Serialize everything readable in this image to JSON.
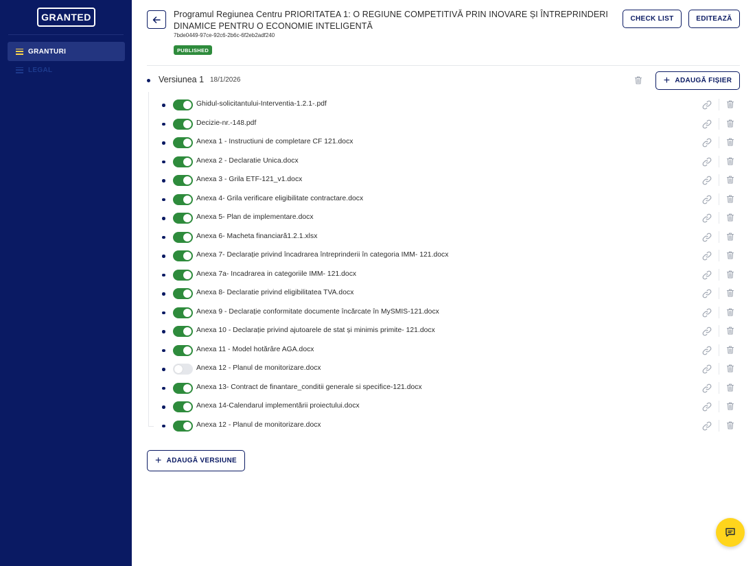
{
  "sidebar": {
    "logo": "GRANTED",
    "items": [
      {
        "label": "GRANTURI",
        "active": true
      },
      {
        "label": "LEGAL",
        "active": false
      }
    ]
  },
  "header": {
    "title": "Programul Regiunea Centru PRIORITATEA 1: O REGIUNE COMPETITIVĂ PRIN INOVARE ȘI ÎNTREPRINDERI DINAMICE PENTRU O ECONOMIE INTELIGENTĂ",
    "id": "7bde0449-97ce-92c6-2b6c-6f2eb2adf240",
    "status_badge": "PUBLISHED",
    "checklist_label": "CHECK LIST",
    "edit_label": "EDITEAZĂ"
  },
  "version": {
    "name": "Versiunea 1",
    "date": "18/1/2026",
    "add_file_label": "ADAUGĂ FIȘIER",
    "files": [
      {
        "name": "Ghidul-solicitantului-Interventia-1.2.1-.pdf",
        "enabled": true
      },
      {
        "name": "Decizie-nr.-148.pdf",
        "enabled": true
      },
      {
        "name": "Anexa 1 - Instructiuni de completare  CF 121.docx",
        "enabled": true
      },
      {
        "name": "Anexa 2 - Declaratie Unica.docx",
        "enabled": true
      },
      {
        "name": "Anexa 3 - Grila ETF-121_v1.docx",
        "enabled": true
      },
      {
        "name": "Anexa 4- Grila verificare eligibilitate contractare.docx",
        "enabled": true
      },
      {
        "name": "Anexa 5- Plan de implementare.docx",
        "enabled": true
      },
      {
        "name": "Anexa 6- Macheta financiară1.2.1.xlsx",
        "enabled": true
      },
      {
        "name": "Anexa 7- Declarație privind încadrarea întreprinderii în categoria IMM- 121.docx",
        "enabled": true
      },
      {
        "name": "Anexa 7a- Incadrarea in categoriile IMM- 121.docx",
        "enabled": true
      },
      {
        "name": "Anexa 8- Declaratie privind eligibilitatea TVA.docx",
        "enabled": true
      },
      {
        "name": "Anexa 9 - Declarație conformitate documente încărcate în MySMIS-121.docx",
        "enabled": true
      },
      {
        "name": "Anexa 10 - Declarație privind ajutoarele de stat și minimis primite- 121.docx",
        "enabled": true
      },
      {
        "name": "Anexa 11 - Model hotărâre AGA.docx",
        "enabled": true
      },
      {
        "name": "Anexa 12 - Planul de monitorizare.docx",
        "enabled": false
      },
      {
        "name": "Anexa 13- Contract de finantare_conditii generale si specifice-121.docx",
        "enabled": true
      },
      {
        "name": "Anexa 14-Calendarul implementării proiectului.docx",
        "enabled": true
      },
      {
        "name": "Anexa 12 - Planul de monitorizare.docx",
        "enabled": true
      }
    ]
  },
  "add_version_label": "ADAUGĂ VERSIUNE",
  "colors": {
    "sidebar_bg": "#0a1a63",
    "accent": "#0a1a63",
    "toggle_on": "#2e8b3c",
    "chat_button": "#ffd51c"
  }
}
